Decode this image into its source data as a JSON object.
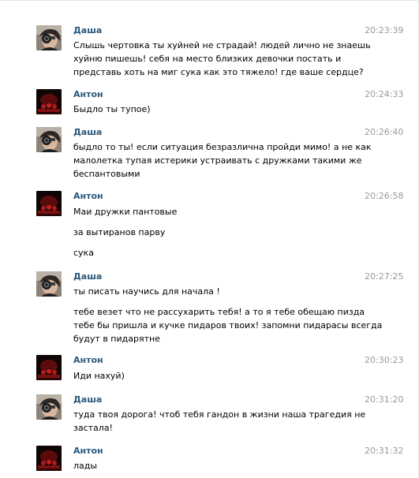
{
  "messages": [
    {
      "author": "Даша",
      "avatar_icon": "user-photo-icon",
      "time": "20:23:39",
      "paragraphs": [
        [
          "Слышь чертовка ты хуйней не страдай! людей лично не знаешь",
          "хуйню пишешь! себя на место близких девочки постать и",
          "представь хоть на миг сука как это тяжело! где ваше сердце?"
        ]
      ]
    },
    {
      "author": "Антон",
      "avatar_icon": "user-photo-icon",
      "time": "20:24:33",
      "paragraphs": [
        [
          "Быдло ты тупое)"
        ]
      ]
    },
    {
      "author": "Даша",
      "avatar_icon": "user-photo-icon",
      "time": "20:26:40",
      "paragraphs": [
        [
          "быдло то ты! если ситуация безразлична пройди мимо! а не как",
          "малолетка тупая истерики устраивать с дружками такими же",
          "беспантовыми"
        ]
      ]
    },
    {
      "author": "Антон",
      "avatar_icon": "user-photo-icon",
      "time": "20:26:58",
      "paragraphs": [
        [
          "Маи дружки пантовые"
        ],
        [
          "за вытиранов парву"
        ],
        [
          "сука"
        ]
      ]
    },
    {
      "author": "Даша",
      "avatar_icon": "user-photo-icon",
      "time": "20:27:25",
      "paragraphs": [
        [
          "ты писать научись для начала !"
        ],
        [
          "тебе везет что не рассухарить тебя! а то я тебе обещаю пизда",
          "тебе бы пришла и кучке пидаров твоих! запомни пидарасы всегда",
          "будут в пидарятне"
        ]
      ]
    },
    {
      "author": "Антон",
      "avatar_icon": "user-photo-icon",
      "time": "20:30:23",
      "paragraphs": [
        [
          "Иди нахуй)"
        ]
      ]
    },
    {
      "author": "Даша",
      "avatar_icon": "user-photo-icon",
      "time": "20:31:20",
      "paragraphs": [
        [
          "туда твоя дорога! чтоб тебя гандон в жизни наша трагедия не",
          "застала!"
        ]
      ]
    },
    {
      "author": "Антон",
      "avatar_icon": "user-photo-icon",
      "time": "20:31:32",
      "paragraphs": [
        [
          "лады"
        ]
      ]
    }
  ],
  "colors": {
    "author_link": "#2b587a",
    "timestamp": "#999999",
    "message_text": "#000000",
    "background": "#ffffff"
  }
}
